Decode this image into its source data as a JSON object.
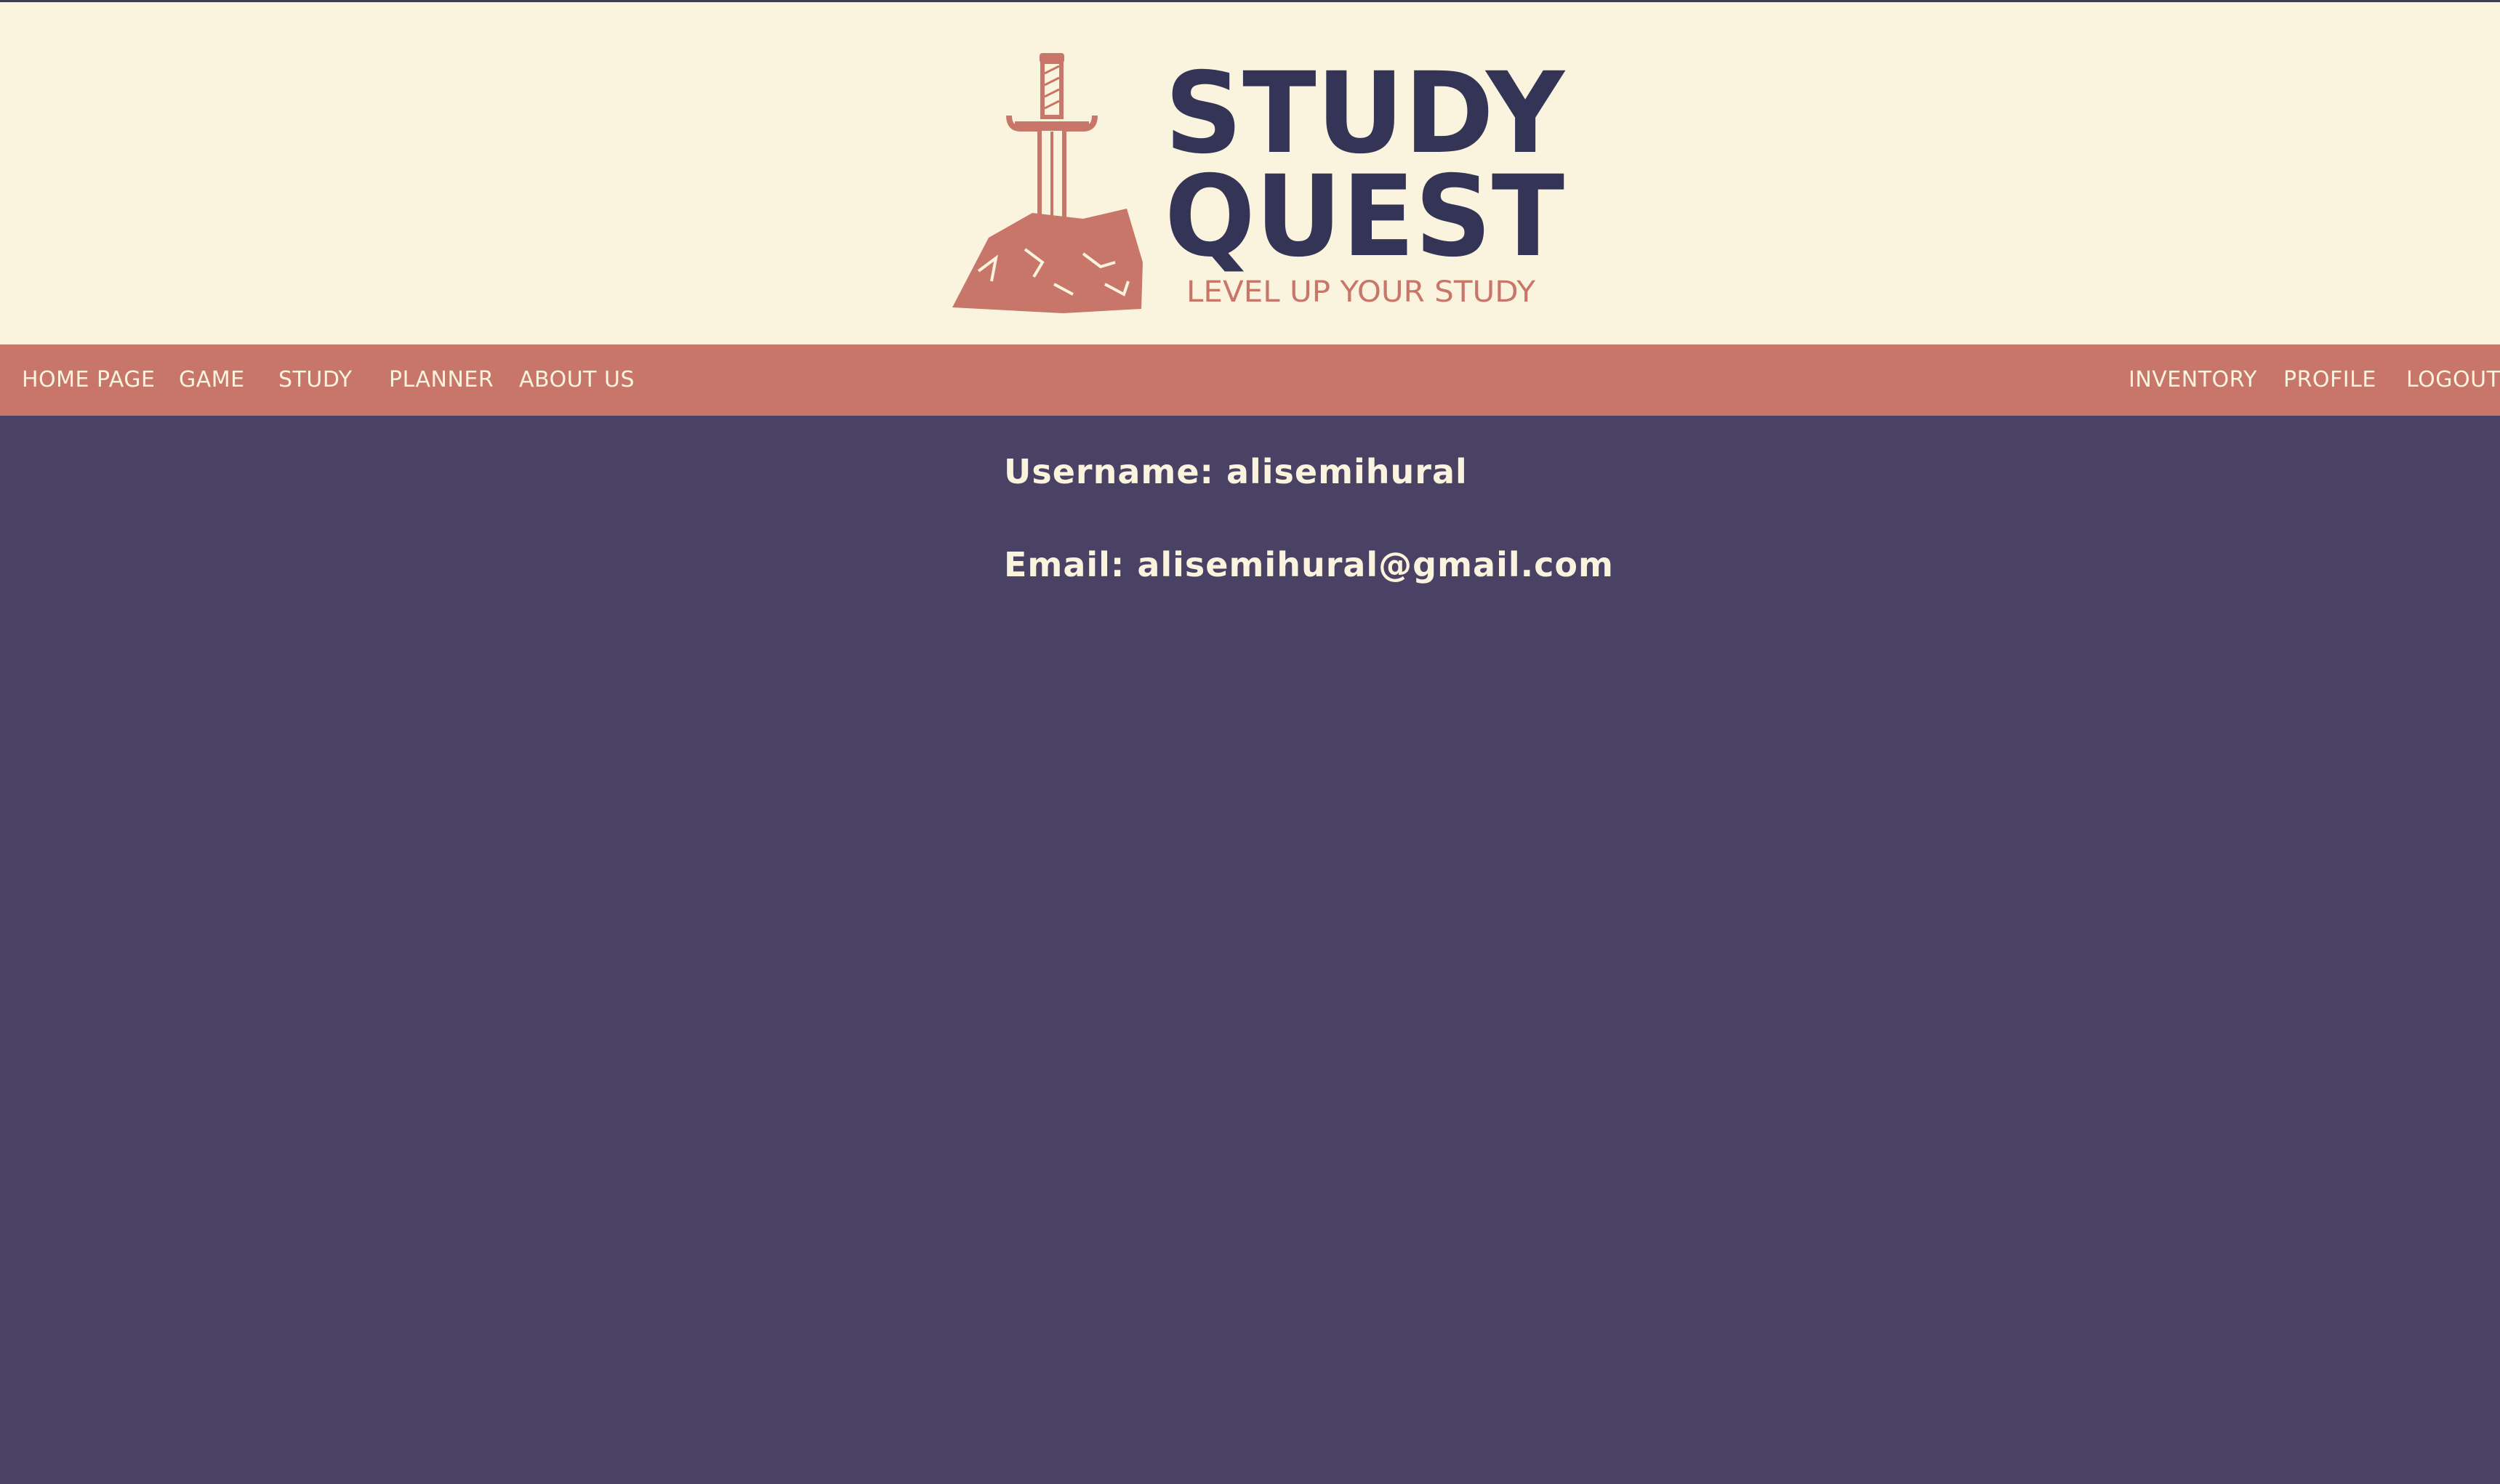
{
  "logo": {
    "title_line1": "STUDY",
    "title_line2": "QUEST",
    "tagline": "LEVEL UP YOUR STUDY",
    "icon": "sword-in-stone-icon"
  },
  "nav": {
    "left": [
      {
        "label": "HOME PAGE"
      },
      {
        "label": "GAME"
      },
      {
        "label": "STUDY"
      },
      {
        "label": "PLANNER"
      },
      {
        "label": "ABOUT US"
      }
    ],
    "right": [
      {
        "label": "INVENTORY"
      },
      {
        "label": "PROFILE"
      },
      {
        "label": "LOGOUT"
      }
    ]
  },
  "profile": {
    "username_line": "Username: alisemihural",
    "email_line": "Email: alisemihural@gmail.com"
  },
  "colors": {
    "header_background": "#faf3dd",
    "nav_background": "#c8766a",
    "page_background": "#4a4264",
    "logo_text": "#343457",
    "logo_accent": "#c8766a",
    "light_text": "#faf3dd"
  }
}
